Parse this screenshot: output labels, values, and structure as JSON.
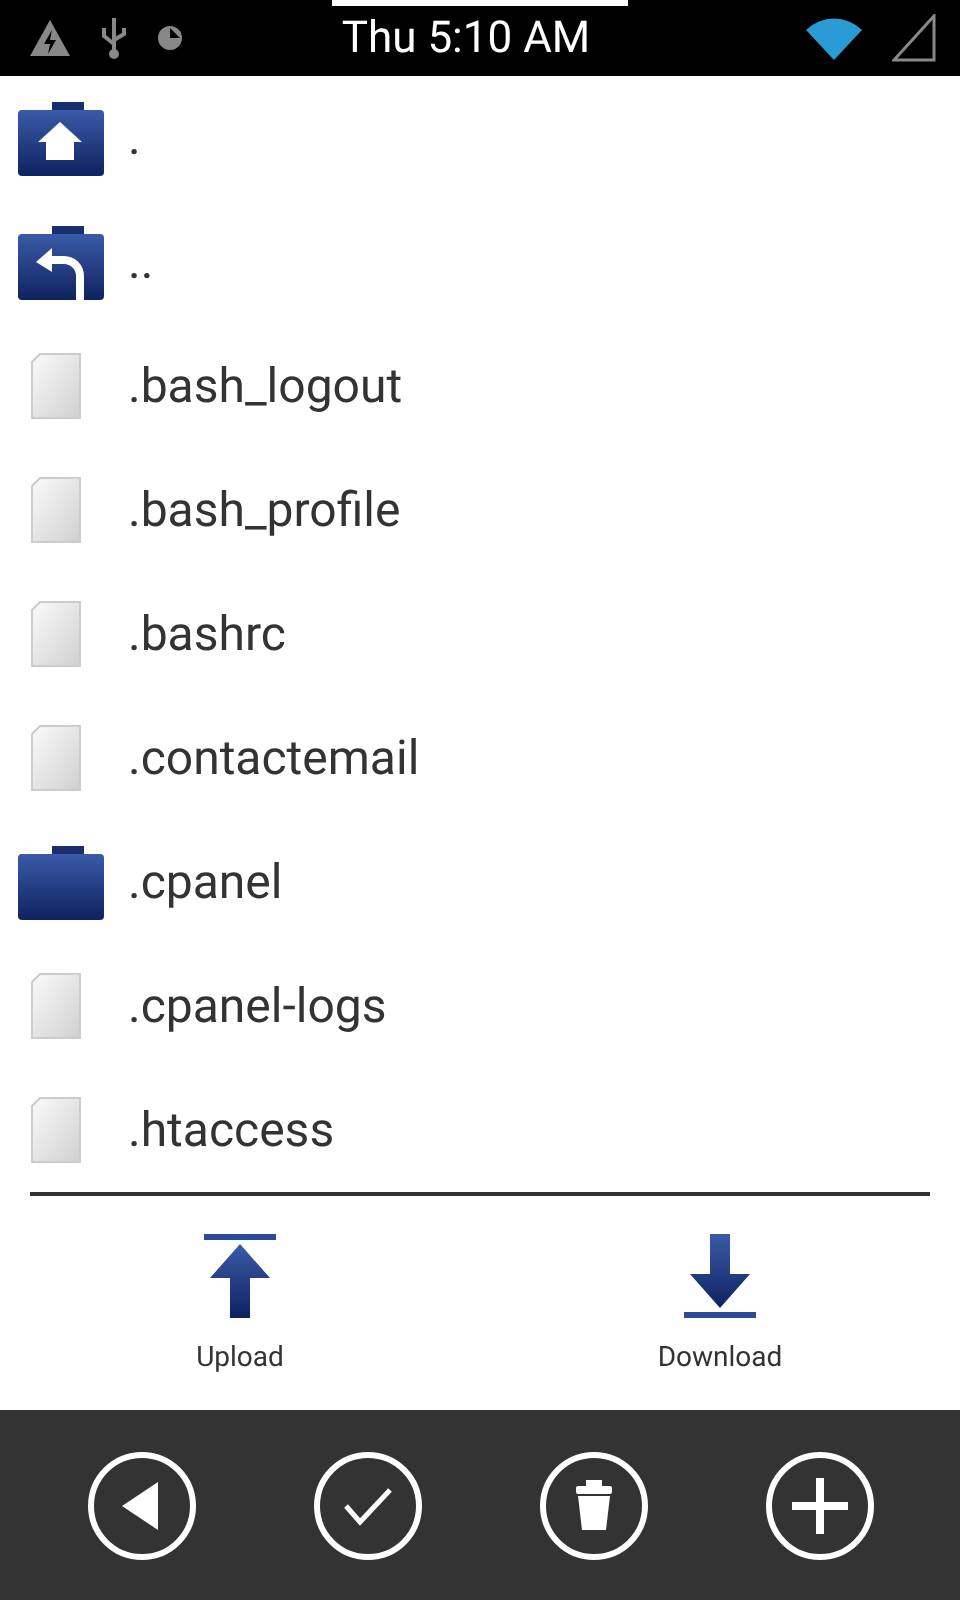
{
  "status_bar": {
    "time": "Thu 5:10 AM"
  },
  "files": [
    {
      "name": ".",
      "kind": "home"
    },
    {
      "name": "..",
      "kind": "up"
    },
    {
      "name": ".bash_logout",
      "kind": "file"
    },
    {
      "name": ".bash_profile",
      "kind": "file"
    },
    {
      "name": ".bashrc",
      "kind": "file"
    },
    {
      "name": ".contactemail",
      "kind": "file"
    },
    {
      "name": ".cpanel",
      "kind": "folder"
    },
    {
      "name": ".cpanel-logs",
      "kind": "file"
    },
    {
      "name": ".htaccess",
      "kind": "file"
    }
  ],
  "actions": [
    {
      "label": "Upload",
      "kind": "upload"
    },
    {
      "label": "Download",
      "kind": "download"
    }
  ],
  "toolbar": [
    {
      "kind": "back"
    },
    {
      "kind": "check"
    },
    {
      "kind": "delete"
    },
    {
      "kind": "add"
    }
  ]
}
